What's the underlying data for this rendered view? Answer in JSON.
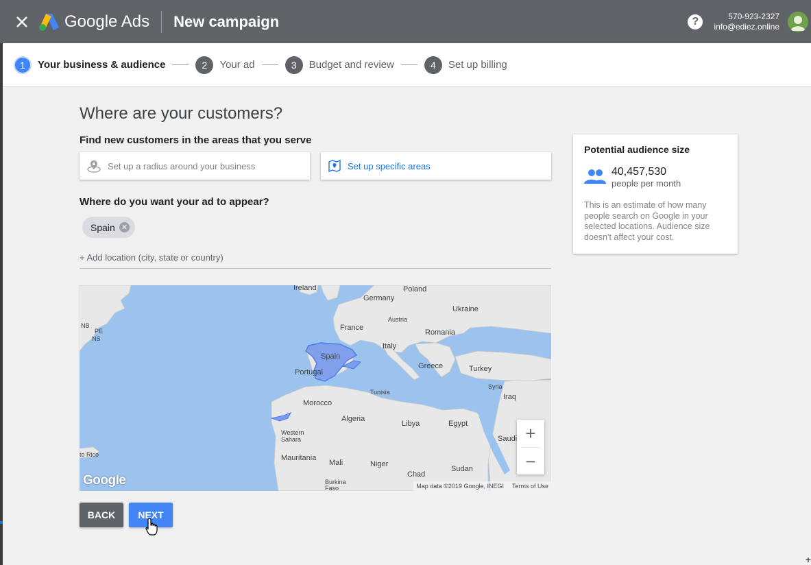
{
  "header": {
    "brand": "Google Ads",
    "title": "New campaign",
    "account_phone": "570-923-2327",
    "account_email": "info@ediez.online"
  },
  "steps": [
    {
      "num": "1",
      "label": "Your business & audience"
    },
    {
      "num": "2",
      "label": "Your ad"
    },
    {
      "num": "3",
      "label": "Budget and review"
    },
    {
      "num": "4",
      "label": "Set up billing"
    }
  ],
  "page": {
    "heading": "Where are your customers?",
    "find_label": "Find new customers in the areas that you serve",
    "radius_option": "Set up a radius around your business",
    "areas_option": "Set up specific areas",
    "appear_label": "Where do you want your ad to appear?",
    "chip": "Spain",
    "add_location": "+ Add location (city, state or country)"
  },
  "map": {
    "labels": {
      "ireland": "Ireland",
      "poland": "Poland",
      "germany": "Germany",
      "ukraine": "Ukraine",
      "austria": "Austria",
      "france": "France",
      "romania": "Romania",
      "italy": "Italy",
      "spain": "Spain",
      "portugal": "Portugal",
      "greece": "Greece",
      "turkey": "Turkey",
      "syria": "Syria",
      "iraq": "Iraq",
      "tunisia": "Tunisia",
      "morocco": "Morocco",
      "algeria": "Algeria",
      "libya": "Libya",
      "egypt": "Egypt",
      "saudi": "Saudi",
      "western_sahara": "Western Sahara",
      "mauritania": "Mauritania",
      "mali": "Mali",
      "niger": "Niger",
      "chad": "Chad",
      "sudan": "Sudan",
      "burkina": "Burkina Faso",
      "nb": "NB",
      "pe": "PE",
      "ns": "NS",
      "rico": "to Rico"
    },
    "google": "Google",
    "attribution": "Map data ©2019 Google, INEGI",
    "terms": "Terms of Use",
    "zoom_in": "+",
    "zoom_out": "−"
  },
  "buttons": {
    "back": "BACK",
    "next": "NEXT"
  },
  "audience": {
    "title": "Potential audience size",
    "count": "40,457,530",
    "unit": "people per month",
    "description": "This is an estimate of how many people search on Google in your selected locations. Audience size doesn't affect your cost."
  },
  "colors": {
    "topbar": "#5f6368",
    "accent": "#4285f4",
    "link": "#1a73e8",
    "highlight_region": "#7b9ded"
  }
}
